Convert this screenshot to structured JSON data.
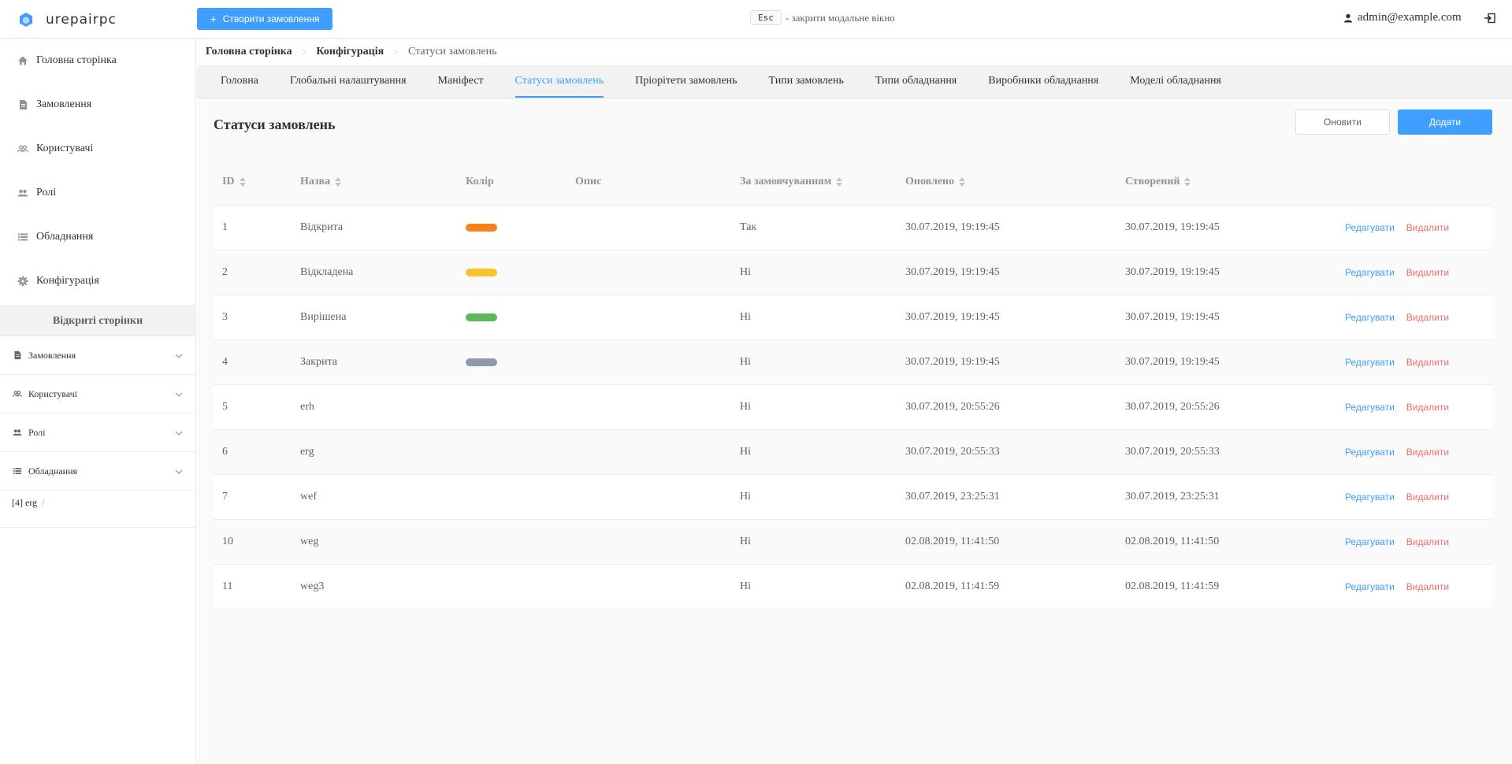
{
  "app": {
    "name": "urepairpc"
  },
  "header": {
    "create_label": "Створити замовлення",
    "hint_key": "Esc",
    "hint_text": "- закрити модальне вікно",
    "user": "admin@example.com"
  },
  "sidebar": {
    "nav": [
      {
        "label": "Головна сторінка",
        "icon": "home-icon"
      },
      {
        "label": "Замовлення",
        "icon": "document-icon"
      },
      {
        "label": "Користувачі",
        "icon": "users-icon"
      },
      {
        "label": "Ролі",
        "icon": "roles-icon"
      },
      {
        "label": "Обладнання",
        "icon": "list-icon"
      },
      {
        "label": "Конфігурація",
        "icon": "gear-icon"
      }
    ],
    "open_pages_title": "Відкриті сторінки",
    "groups": [
      {
        "label": "Замовлення",
        "icon": "document-icon"
      },
      {
        "label": "Користувачі",
        "icon": "users-icon"
      },
      {
        "label": "Ролі",
        "icon": "roles-icon"
      },
      {
        "label": "Обладнання",
        "icon": "list-icon"
      }
    ],
    "open_page": {
      "label": "[4] erg",
      "sep": "/"
    }
  },
  "breadcrumb": [
    "Головна сторінка",
    "Конфігурація",
    "Статуси замовлень"
  ],
  "tabs": [
    "Головна",
    "Глобальні налаштування",
    "Маніфест",
    "Статуси замовлень",
    "Пріорітети замовлень",
    "Типи замовлень",
    "Типи обладнання",
    "Виробники обладнання",
    "Моделі обладнання"
  ],
  "active_tab": 3,
  "page": {
    "title": "Статуси замовлень",
    "refresh_label": "Оновити",
    "add_label": "Додати"
  },
  "table": {
    "columns": [
      "ID",
      "Назва",
      "Колір",
      "Опис",
      "За замовчуванням",
      "Оновлено",
      "Створений"
    ],
    "edit_label": "Редагувати",
    "delete_label": "Видалити",
    "rows": [
      {
        "id": "1",
        "name": "Відкрита",
        "color": "#f5821f",
        "desc": "",
        "default": "Так",
        "updated": "30.07.2019, 19:19:45",
        "created": "30.07.2019, 19:19:45"
      },
      {
        "id": "2",
        "name": "Відкладена",
        "color": "#f9c32b",
        "desc": "",
        "default": "Ні",
        "updated": "30.07.2019, 19:19:45",
        "created": "30.07.2019, 19:19:45"
      },
      {
        "id": "3",
        "name": "Вирішена",
        "color": "#5cb85c",
        "desc": "",
        "default": "Ні",
        "updated": "30.07.2019, 19:19:45",
        "created": "30.07.2019, 19:19:45"
      },
      {
        "id": "4",
        "name": "Закрита",
        "color": "#8e9aab",
        "desc": "",
        "default": "Ні",
        "updated": "30.07.2019, 19:19:45",
        "created": "30.07.2019, 19:19:45"
      },
      {
        "id": "5",
        "name": "erh",
        "color": "",
        "desc": "",
        "default": "Ні",
        "updated": "30.07.2019, 20:55:26",
        "created": "30.07.2019, 20:55:26"
      },
      {
        "id": "6",
        "name": "erg",
        "color": "",
        "desc": "",
        "default": "Ні",
        "updated": "30.07.2019, 20:55:33",
        "created": "30.07.2019, 20:55:33"
      },
      {
        "id": "7",
        "name": "wef",
        "color": "",
        "desc": "",
        "default": "Ні",
        "updated": "30.07.2019, 23:25:31",
        "created": "30.07.2019, 23:25:31"
      },
      {
        "id": "10",
        "name": "weg",
        "color": "",
        "desc": "",
        "default": "Ні",
        "updated": "02.08.2019, 11:41:50",
        "created": "02.08.2019, 11:41:50"
      },
      {
        "id": "11",
        "name": "weg3",
        "color": "",
        "desc": "",
        "default": "Ні",
        "updated": "02.08.2019, 11:41:59",
        "created": "02.08.2019, 11:41:59"
      }
    ]
  },
  "colors": {
    "accent": "#409eff",
    "danger": "#f56c6c"
  }
}
